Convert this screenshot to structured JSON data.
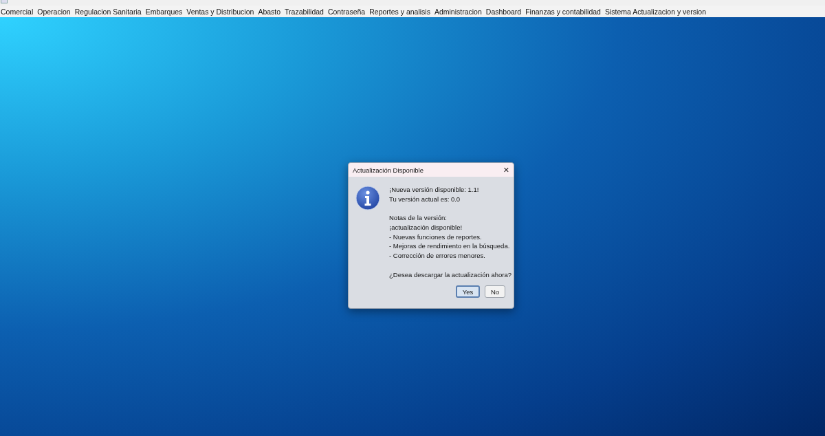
{
  "menu_bar": {
    "items": [
      {
        "label": "Comercial"
      },
      {
        "label": "Operacion"
      },
      {
        "label": "Regulacion Sanitaria"
      },
      {
        "label": "Embarques"
      },
      {
        "label": "Ventas y Distribucion"
      },
      {
        "label": "Abasto"
      },
      {
        "label": "Trazabilidad"
      },
      {
        "label": "Contraseña"
      },
      {
        "label": "Reportes y analisis"
      },
      {
        "label": "Administracion"
      },
      {
        "label": "Dashboard"
      },
      {
        "label": "Finanzas y contabilidad"
      },
      {
        "label": "Sistema Actualizacion y version"
      }
    ]
  },
  "dialog": {
    "title": "Actualización Disponible",
    "close": "✕",
    "paragraphs": [
      {
        "lines": [
          "¡Nueva versión disponible: 1.1!",
          "Tu versión actual es: 0.0"
        ]
      },
      {
        "lines": [
          "Notas de la versión:",
          "¡actualización disponible!",
          "- Nuevas funciones de reportes.",
          "- Mejoras de rendimiento en la búsqueda.",
          "- Corrección de errores menores."
        ]
      },
      {
        "lines": [
          "¿Desea descargar la actualización ahora?"
        ]
      }
    ],
    "buttons": [
      {
        "label": "Yes",
        "selected": true
      },
      {
        "label": "No",
        "selected": false
      }
    ]
  }
}
